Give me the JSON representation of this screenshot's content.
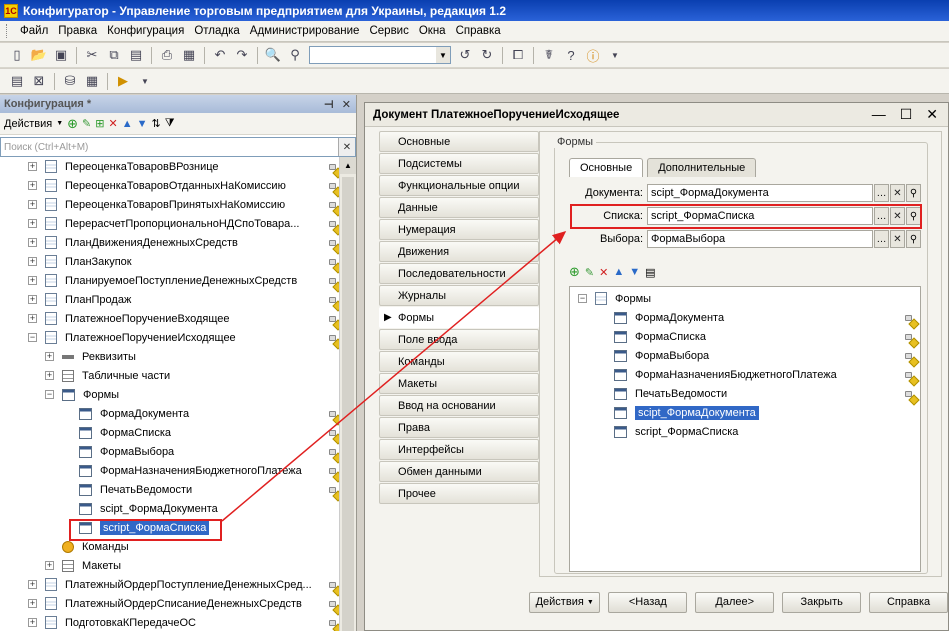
{
  "window": {
    "title": "Конфигуратор - Управление торговым предприятием для Украины, редакция 1.2",
    "logo": "1C"
  },
  "menu": [
    "Файл",
    "Правка",
    "Конфигурация",
    "Отладка",
    "Администрирование",
    "Сервис",
    "Окна",
    "Справка"
  ],
  "config_panel": {
    "title": "Конфигурация *",
    "actions_label": "Действия",
    "search_placeholder": "Поиск (Ctrl+Alt+M)",
    "tree": [
      {
        "label": "ПереоценкаТоваровВРознице",
        "level": 0,
        "icon": "doc",
        "expander": "+",
        "lock": "lock"
      },
      {
        "label": "ПереоценкаТоваровОтданныхНаКомиссию",
        "level": 0,
        "icon": "doc",
        "expander": "+",
        "lock": "lock"
      },
      {
        "label": "ПереоценкаТоваровПринятыхНаКомиссию",
        "level": 0,
        "icon": "doc",
        "expander": "+",
        "lock": "lock"
      },
      {
        "label": "ПерерасчетПропорциональноНДСпоТовара...",
        "level": 0,
        "icon": "doc",
        "expander": "+",
        "lock": "lock"
      },
      {
        "label": "ПланДвиженияДенежныхСредств",
        "level": 0,
        "icon": "doc",
        "expander": "+",
        "lock": "lock"
      },
      {
        "label": "ПланЗакупок",
        "level": 0,
        "icon": "doc",
        "expander": "+",
        "lock": "lock"
      },
      {
        "label": "ПланируемоеПоступлениеДенежныхСредств",
        "level": 0,
        "icon": "doc",
        "expander": "+",
        "lock": "lock"
      },
      {
        "label": "ПланПродаж",
        "level": 0,
        "icon": "doc",
        "expander": "+",
        "lock": "lock"
      },
      {
        "label": "ПлатежноеПоручениеВходящее",
        "level": 0,
        "icon": "doc",
        "expander": "+",
        "lock": "lock"
      },
      {
        "label": "ПлатежноеПоручениеИсходящее",
        "level": 0,
        "icon": "doc",
        "expander": "−",
        "lock": "arrow"
      },
      {
        "label": "Реквизиты",
        "level": 1,
        "icon": "attr",
        "expander": "+",
        "lock": ""
      },
      {
        "label": "Табличные части",
        "level": 1,
        "icon": "table",
        "expander": "+",
        "lock": ""
      },
      {
        "label": "Формы",
        "level": 1,
        "icon": "form",
        "expander": "−",
        "lock": ""
      },
      {
        "label": "ФормаДокумента",
        "level": 2,
        "icon": "form",
        "expander": "",
        "lock": "lock"
      },
      {
        "label": "ФормаСписка",
        "level": 2,
        "icon": "form",
        "expander": "",
        "lock": "lock"
      },
      {
        "label": "ФормаВыбора",
        "level": 2,
        "icon": "form",
        "expander": "",
        "lock": "lock"
      },
      {
        "label": "ФормаНазначенияБюджетногоПлатежа",
        "level": 2,
        "icon": "form",
        "expander": "",
        "lock": "lock"
      },
      {
        "label": "ПечатьВедомости",
        "level": 2,
        "icon": "form",
        "expander": "",
        "lock": "lock"
      },
      {
        "label": "scipt_ФормаДокумента",
        "level": 2,
        "icon": "form",
        "expander": "",
        "lock": ""
      },
      {
        "label": "script_ФормаСписка",
        "level": 2,
        "icon": "form",
        "expander": "",
        "lock": "",
        "selected": true
      },
      {
        "label": "Команды",
        "level": 1,
        "icon": "cmd",
        "expander": "",
        "lock": ""
      },
      {
        "label": "Макеты",
        "level": 1,
        "icon": "table",
        "expander": "+",
        "lock": ""
      },
      {
        "label": "ПлатежныйОрдерПоступлениеДенежныхСред...",
        "level": 0,
        "icon": "doc",
        "expander": "+",
        "lock": "lock"
      },
      {
        "label": "ПлатежныйОрдерСписаниеДенежныхСредств",
        "level": 0,
        "icon": "doc",
        "expander": "+",
        "lock": "lock"
      },
      {
        "label": "ПодготовкаКПередачеОС",
        "level": 0,
        "icon": "doc",
        "expander": "+",
        "lock": "lock"
      }
    ]
  },
  "doc_window": {
    "title": "Документ ПлатежноеПоручениеИсходящее",
    "nav": [
      "Основные",
      "Подсистемы",
      "Функциональные опции",
      "Данные",
      "Нумерация",
      "Движения",
      "Последовательности",
      "Журналы",
      "Формы",
      "Поле ввода",
      "Команды",
      "Макеты",
      "Ввод на основании",
      "Права",
      "Интерфейсы",
      "Обмен данными",
      "Прочее"
    ],
    "nav_active": "Формы",
    "group_title": "Формы",
    "tabs": [
      "Основные",
      "Дополнительные"
    ],
    "fields": [
      {
        "label": "Документа:",
        "value": "scipt_ФормаДокумента"
      },
      {
        "label": "Списка:",
        "value": "script_ФормаСписка"
      },
      {
        "label": "Выбора:",
        "value": "ФормаВыбора"
      }
    ],
    "forms_tree_root": "Формы",
    "forms_tree": [
      {
        "label": "ФормаДокумента",
        "lock": true
      },
      {
        "label": "ФормаСписка",
        "lock": true
      },
      {
        "label": "ФормаВыбора",
        "lock": true
      },
      {
        "label": "ФормаНазначенияБюджетногоПлатежа",
        "lock": true
      },
      {
        "label": "ПечатьВедомости",
        "lock": true
      },
      {
        "label": "scipt_ФормаДокумента",
        "lock": false,
        "selected": true
      },
      {
        "label": "script_ФормаСписка",
        "lock": false
      }
    ],
    "buttons": {
      "actions": "Действия",
      "back": "<Назад",
      "next": "Далее>",
      "close": "Закрыть",
      "help": "Справка"
    }
  },
  "colors": {
    "highlight_box": "#e02020",
    "selection": "#3168c6"
  }
}
